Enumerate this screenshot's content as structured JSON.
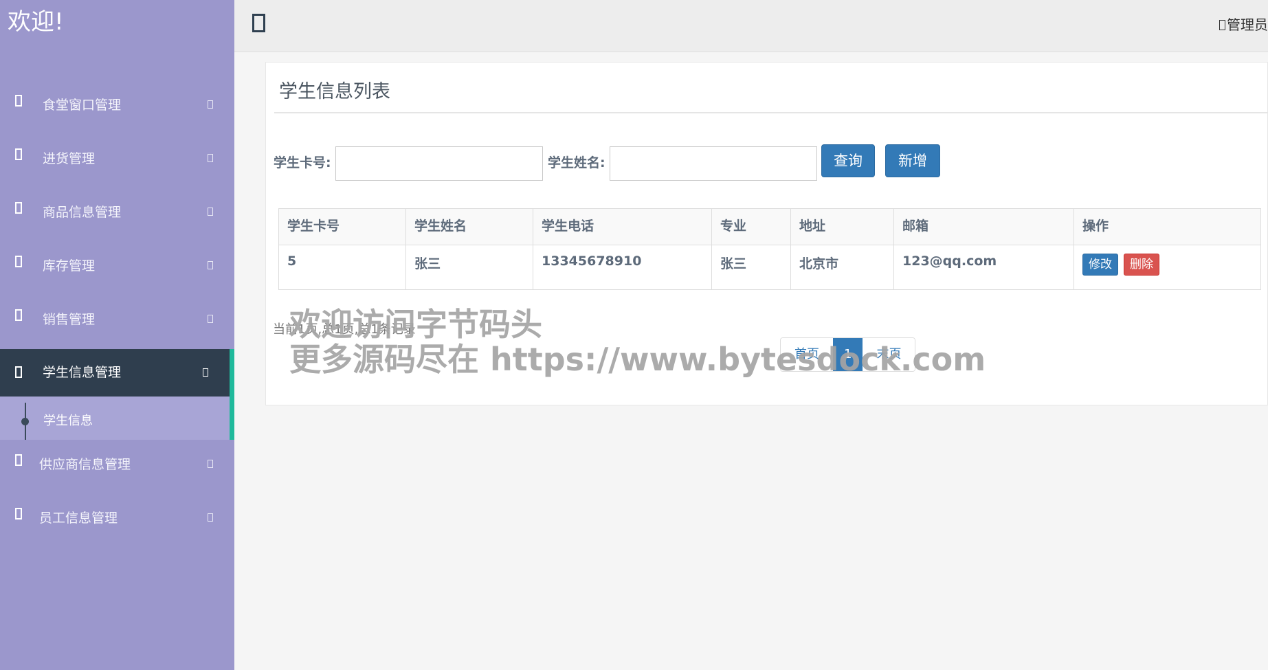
{
  "sidebar": {
    "brand": "欢迎!",
    "items": [
      {
        "label": "食堂窗口管理"
      },
      {
        "label": "进货管理"
      },
      {
        "label": "商品信息管理"
      },
      {
        "label": "库存管理"
      },
      {
        "label": "销售管理"
      },
      {
        "label": "学生信息管理"
      },
      {
        "label": "供应商信息管理"
      },
      {
        "label": "员工信息管理"
      }
    ],
    "submenu": {
      "label": "学生信息"
    }
  },
  "topbar": {
    "user_label": "管理员"
  },
  "panel": {
    "title": "学生信息列表",
    "search": {
      "card_label": "学生卡号:",
      "card_value": "",
      "name_label": "学生姓名:",
      "name_value": "",
      "query_button": "查询",
      "add_button": "新增"
    },
    "table": {
      "headers": [
        "学生卡号",
        "学生姓名",
        "学生电话",
        "专业",
        "地址",
        "邮箱",
        "操作"
      ],
      "rows": [
        {
          "card": "5",
          "name": "张三",
          "phone": "13345678910",
          "major": "张三",
          "address": "北京市",
          "email": "123@qq.com",
          "edit": "修改",
          "delete": "删除"
        }
      ]
    },
    "page_info": "当前1页,总1页,总1条记录",
    "pager": {
      "first": "首页",
      "current": "1",
      "last": "末页"
    }
  },
  "watermark": {
    "line1": "欢迎访问字节码头",
    "line2": "更多源码尽在  https://www.bytesdock.com"
  }
}
